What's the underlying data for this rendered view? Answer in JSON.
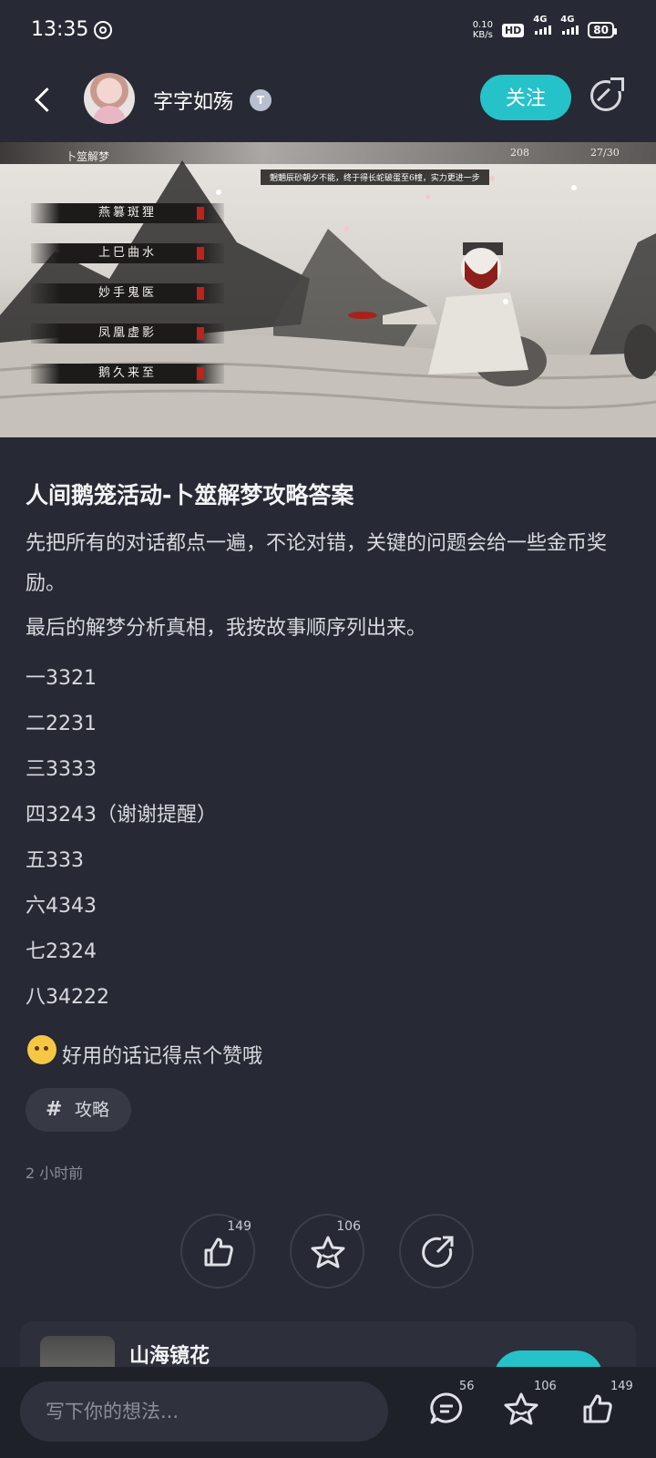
{
  "status_bar": {
    "time": "13:35",
    "net_speed_value": "0.10",
    "net_speed_unit": "KB/s",
    "hd": "HD",
    "sim1_label": "4G",
    "sim2_label": "4G",
    "battery": "80"
  },
  "header": {
    "username": "字字如殇",
    "badge": "T",
    "follow_label": "关注"
  },
  "banner": {
    "game_title": "卜筮解梦",
    "resource_1": "208",
    "resource_2": "27/30",
    "notice": "魍魉辰砂朝夕不能，终于得长蛇破蛋至6幢，实力更进一步",
    "options": [
      "燕篡斑狸",
      "上巳曲水",
      "妙手鬼医",
      "凤凰虚影",
      "鹅久来至"
    ]
  },
  "article": {
    "title": "人间鹅笼活动-卜筮解梦攻略答案",
    "para1": "先把所有的对话都点一遍，不论对错，关键的问题会给一些金币奖励。",
    "para2": "最后的解梦分析真相，我按故事顺序列出来。",
    "answers": [
      "一3321",
      "二2231",
      "三3333",
      "四3243（谢谢提醒）",
      "五333",
      "六4343",
      "七2324",
      "八34222"
    ],
    "closing": "好用的话记得点个赞哦",
    "tag": "攻略",
    "time_ago": "2 小时前"
  },
  "actions": {
    "like_count": "149",
    "fav_count": "106"
  },
  "related_card": {
    "name": "山海镜花"
  },
  "bottom_bar": {
    "comment_placeholder": "写下你的想法...",
    "comment_count": "56",
    "fav_count": "106",
    "like_count": "149"
  }
}
